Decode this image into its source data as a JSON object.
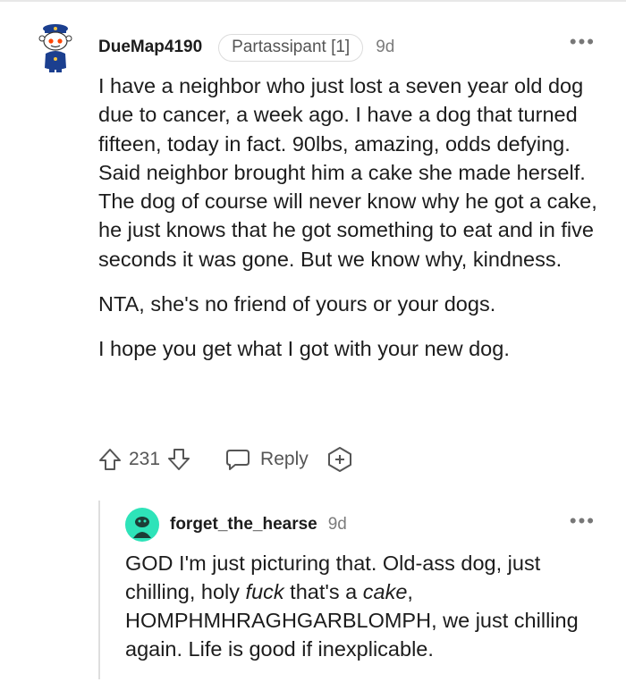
{
  "comment": {
    "username": "DueMap4190",
    "flair": "Partassipant [1]",
    "age": "9d",
    "more_label": "•••",
    "paragraphs": [
      "I have a neighbor who just lost a seven year old dog due to cancer, a week ago. I have a dog that turned fifteen, today in fact. 90lbs, amazing, odds defying. Said neighbor brought him a cake she made herself. The dog of course will never know why he got a cake, he just knows that he got something to eat and in five seconds it was gone. But we know why, kindness.",
      "NTA, she's no friend of yours or your dogs.",
      "I hope you get what I got with your new dog."
    ],
    "score": "231",
    "reply_label": "Reply",
    "icons": [
      "upvote-icon",
      "downvote-icon",
      "reply-bubble-icon",
      "award-plus-icon"
    ]
  },
  "reply": {
    "username": "forget_the_hearse",
    "age": "9d",
    "more_label": "•••",
    "text_parts": {
      "a": "GOD I'm just picturing that. Old-ass dog, just chilling, holy ",
      "b": "fuck",
      "c": " that's a ",
      "d": "cake",
      "e": ", HOMPHMHRAGHGARBLOMPH, we just chilling again. Life is good if inexplicable."
    }
  },
  "colors": {
    "text": "#1c1c1c",
    "meta": "#7c7c7c",
    "reply_avatar": "#2ee3b9",
    "avatar_blue": "#1b3f8f",
    "snoo_red": "#ff4500"
  }
}
